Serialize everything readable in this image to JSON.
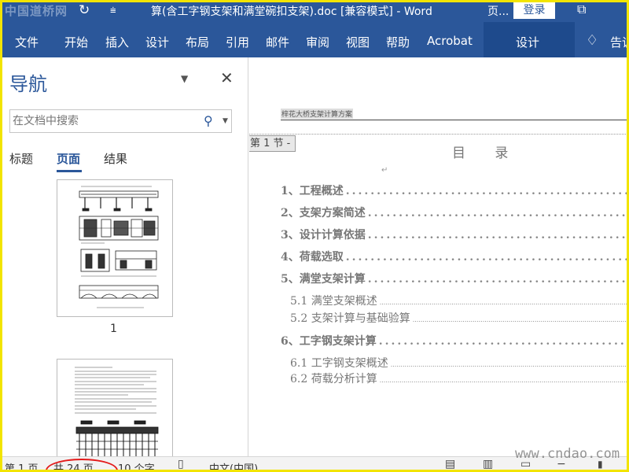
{
  "titlebar": {
    "watermark": "中国道桥网",
    "title": "算(含工字钢支架和满堂碗扣支架).doc [兼容模式]  -  Word",
    "page_hint": "页...",
    "login": "登录",
    "icons": [
      "refresh-icon",
      "customize-icon",
      "restore-icon"
    ]
  },
  "ribbon": {
    "tabs": [
      "文件",
      "开始",
      "插入",
      "设计",
      "布局",
      "引用",
      "邮件",
      "审阅",
      "视图",
      "帮助",
      "Acrobat"
    ],
    "context_tab": "设计",
    "tell_me": "告诉"
  },
  "nav": {
    "title": "导航",
    "search_placeholder": "在文档中搜索",
    "tabs": [
      "标题",
      "页面",
      "结果"
    ],
    "active_tab": "页面",
    "page_label": "1"
  },
  "doc": {
    "header_text": "梓花大桥支架计算方案",
    "section_tag": "第 1 节 -",
    "toc_title": "目 录",
    "para_mark": "↵",
    "toc": [
      {
        "text": "1、工程概述",
        "level": 1
      },
      {
        "text": "2、支架方案简述",
        "level": 1
      },
      {
        "text": "3、设计计算依据",
        "level": 1
      },
      {
        "text": "4、荷载选取",
        "level": 1
      },
      {
        "text": "5、满堂支架计算",
        "level": 1
      },
      {
        "text": "5.1 满堂支架概述",
        "level": 2
      },
      {
        "text": "5.2 支架计算与基础验算",
        "level": 2
      },
      {
        "text": "6、工字钢支架计算",
        "level": 1
      },
      {
        "text": "6.1 工字钢支架概述",
        "level": 2
      },
      {
        "text": "6.2 荷载分析计算",
        "level": 2
      }
    ]
  },
  "statusbar": {
    "page": "第 1 页",
    "total": "共 24 页",
    "words": "10 个字",
    "language": "中文(中国)"
  },
  "watermark_site": "www.cndao.com"
}
